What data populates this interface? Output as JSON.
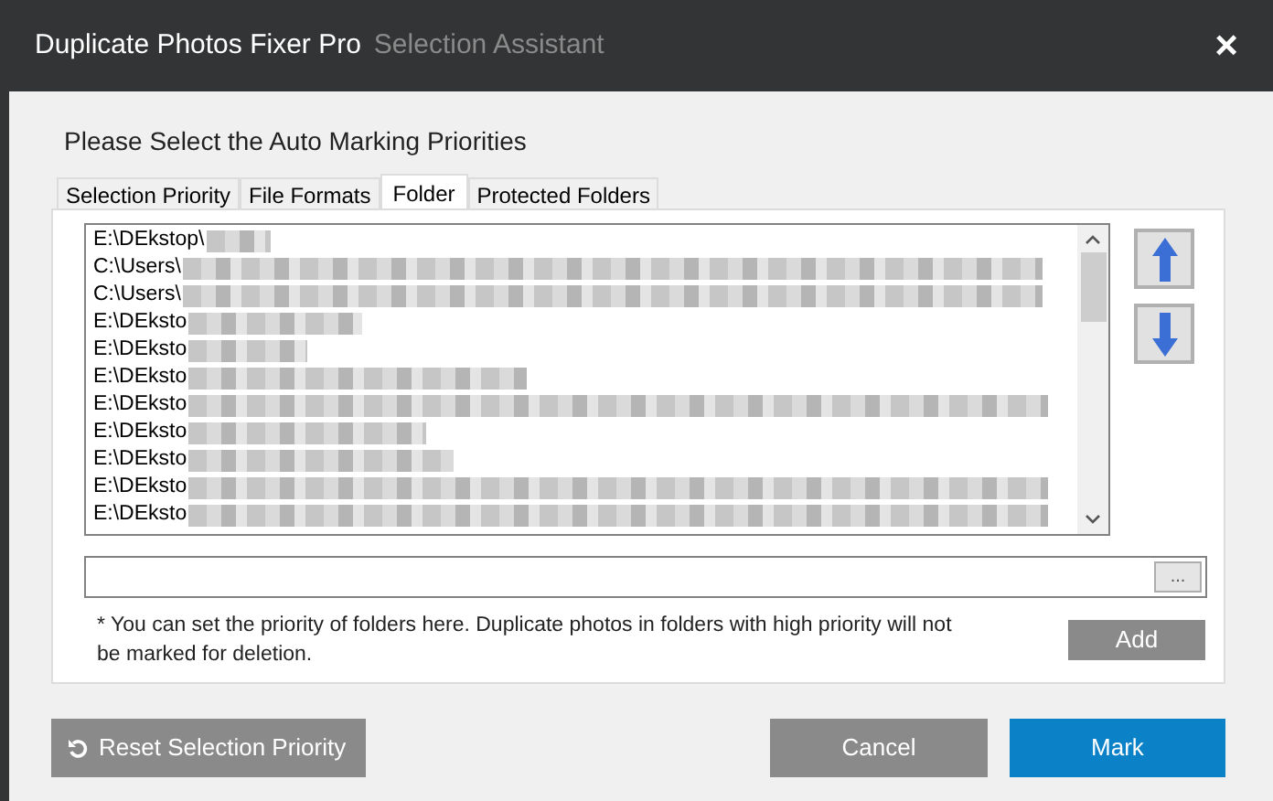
{
  "window": {
    "title": "Duplicate Photos Fixer Pro",
    "subtitle": "Selection Assistant",
    "close": "×"
  },
  "heading": "Please Select the Auto Marking Priorities",
  "tabs": [
    {
      "label": "Selection Priority",
      "selected": false
    },
    {
      "label": "File Formats",
      "selected": false
    },
    {
      "label": "Folder",
      "selected": true
    },
    {
      "label": "Protected Folders",
      "selected": false
    }
  ],
  "folders": [
    {
      "path": "E:\\DEkstop\\",
      "redacted": true
    },
    {
      "path": "C:\\Users\\",
      "redacted": true
    },
    {
      "path": "C:\\Users\\",
      "redacted": true
    },
    {
      "path": "E:\\DEksto",
      "redacted": true
    },
    {
      "path": "E:\\DEksto",
      "redacted": true
    },
    {
      "path": "E:\\DEksto",
      "redacted": true
    },
    {
      "path": "E:\\DEksto",
      "redacted": true
    },
    {
      "path": "E:\\DEksto",
      "redacted": true
    },
    {
      "path": "E:\\DEksto",
      "redacted": true
    },
    {
      "path": "E:\\DEksto",
      "redacted": true
    },
    {
      "path": "E:\\DEksto",
      "redacted": true
    }
  ],
  "browse_button": "...",
  "note": "* You can set the priority of folders here. Duplicate photos in folders with high priority will not be marked for deletion.",
  "add_button": "Add",
  "reset_button": "Reset Selection Priority",
  "cancel_button": "Cancel",
  "mark_button": "Mark"
}
